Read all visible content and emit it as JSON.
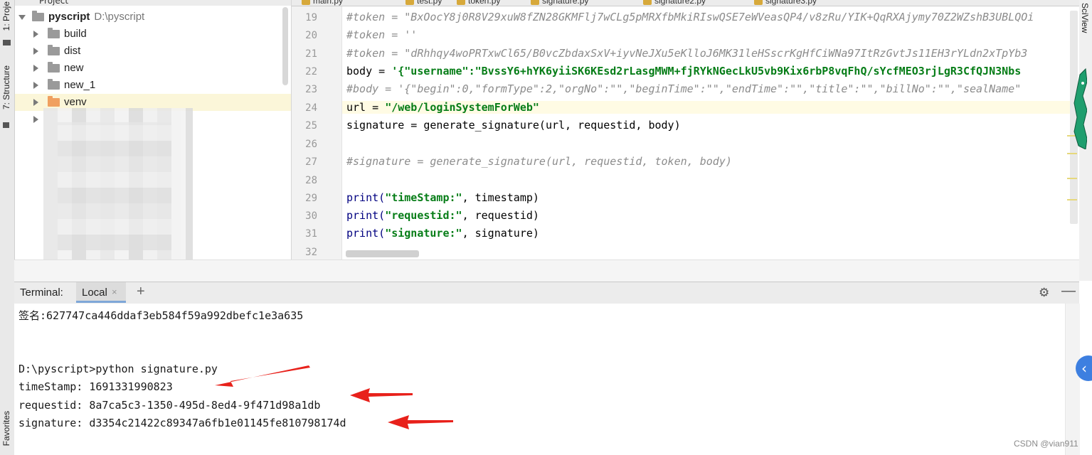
{
  "left_strip": {
    "project_tab": "1: Proje",
    "structure_tab": "7: Structure",
    "favorites_tab": "Favorites"
  },
  "right_strip": {
    "sciview_tab": "SciView"
  },
  "file_tabs": [
    "main.py",
    "test.py",
    "token.py",
    "signature.py",
    "signature2.py",
    "signature3.py"
  ],
  "project": {
    "header": "Project",
    "root": {
      "name": "pyscript",
      "path": "D:\\pyscript"
    },
    "items": [
      {
        "name": "build"
      },
      {
        "name": "dist"
      },
      {
        "name": "new"
      },
      {
        "name": "new_1"
      },
      {
        "name": "venv"
      }
    ]
  },
  "editor": {
    "line_numbers": [
      "19",
      "20",
      "21",
      "22",
      "23",
      "24",
      "25",
      "26",
      "27",
      "28",
      "29",
      "30",
      "31",
      "32"
    ],
    "lines": {
      "l19": "#token = \"BxOocY8j0R8V29xuW8fZN28GKMFlj7wCLg5pMRXfbMkiRIswQSE7eWVeasQP4/v8zRu/YIK+QqRXAjymy70Z2WZshB3UBLQOi",
      "l20": "#token = ''",
      "l21": "#token = \"dRhhqy4woPRTxwCl65/B0vcZbdaxSxV+iyvNeJXu5eKlloJ6MK31leHSscrKgHfCiWNa97ItRzGvtJs11EH3rYLdn2xTpYb3",
      "l22_prefix": "body = ",
      "l22_string": "'{\"username\":\"BvssY6+hYK6yiiSK6KEsd2rLasgMWM+fjRYkNGecLkU5vb9Kix6rbP8vqFhQ/sYcfMEO3rjLgR3CfQJN3Nbs",
      "l23": "#body = '{\"begin\":0,\"formType\":2,\"orgNo\":\"\",\"beginTime\":\"\",\"endTime\":\"\",\"title\":\"\",\"billNo\":\"\",\"sealName\"",
      "l24_prefix": "url = ",
      "l24_string": "\"/web/loginSystemForWeb\"",
      "l25": "signature = generate_signature(url, requestid, body)",
      "l27": "#signature = generate_signature(url, requestid, token, body)",
      "l29_fn": "print(",
      "l29_str": "\"timeStamp:\"",
      "l29_rest": ", timestamp)",
      "l30_fn": "print(",
      "l30_str": "\"requestid:\"",
      "l30_rest": ", requestid)",
      "l31_fn": "print(",
      "l31_str": "\"signature:\"",
      "l31_rest": ", signature)"
    }
  },
  "terminal": {
    "title": "Terminal:",
    "tab_label": "Local",
    "tab_close": "×",
    "add": "+",
    "gear": "⚙",
    "minimize": "—",
    "lines": [
      "签名:627747ca446ddaf3eb584f59a992dbefc1e3a635",
      "D:\\pyscript>python signature.py",
      "timeStamp: 1691331990823",
      "requestid: 8a7ca5c3-1350-495d-8ed4-9f471d98a1db",
      "signature: d3354c21422c89347a6fb1e01145fe810798174d"
    ]
  },
  "annotation_color": "#e8211b",
  "accent_color": "#3d7fe0",
  "floating_button": "‹",
  "watermark": "CSDN @vian911"
}
